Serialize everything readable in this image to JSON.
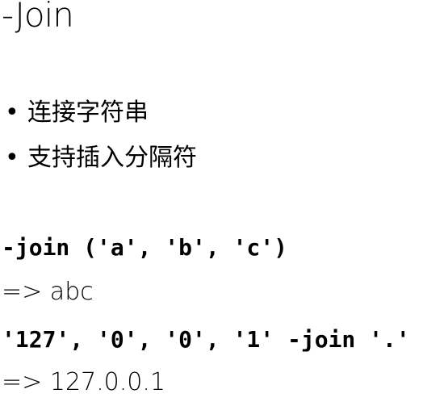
{
  "title": "-Join",
  "bullets": [
    "连接字符串",
    "支持插入分隔符"
  ],
  "bullet_glyph": "•",
  "examples": [
    {
      "code": "-join ('a', 'b', 'c')",
      "result": "=> abc"
    },
    {
      "code": "'127', '0', '0', '1' -join '.'",
      "result": "=> 127.0.0.1"
    }
  ]
}
